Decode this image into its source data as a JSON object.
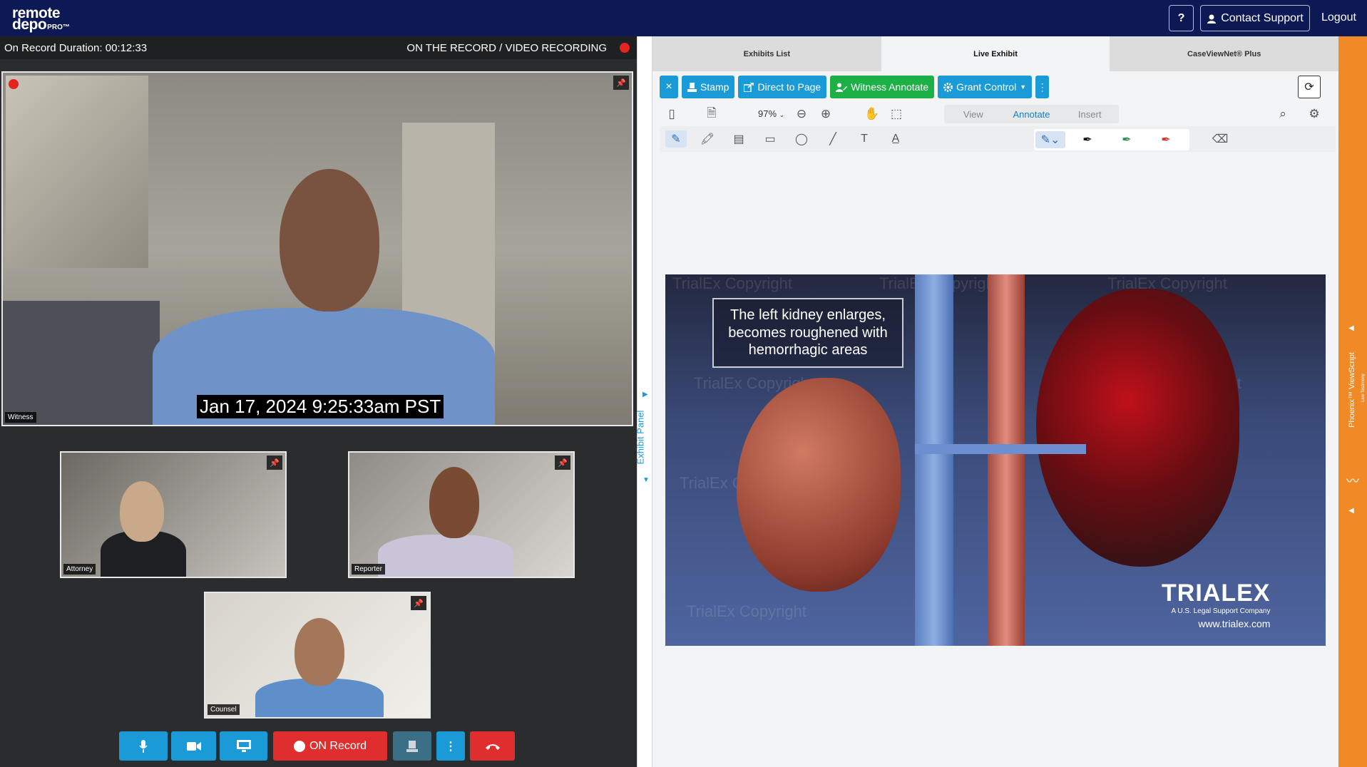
{
  "header": {
    "logo_line1": "remote",
    "logo_line2": "depo",
    "logo_pro": "PRO™",
    "help_label": "?",
    "contact_label": "Contact Support",
    "logout_label": "Logout"
  },
  "recording": {
    "duration": "On Record Duration: 00:12:33",
    "status": "ON THE RECORD / VIDEO RECORDING"
  },
  "video": {
    "witness_label": "Witness",
    "timestamp": "Jan 17, 2024  9:25:33am PST",
    "attorney_label": "Attorney",
    "reporter_label": "Reporter",
    "counsel_label": "Counsel"
  },
  "controls": {
    "on_record_label": "ON Record"
  },
  "exhibit_panel": {
    "label": "Exhibit Panel"
  },
  "tabs": [
    {
      "label": "Exhibits List",
      "active": false
    },
    {
      "label": "Live Exhibit",
      "active": true
    },
    {
      "label": "CaseViewNet® Plus",
      "active": false
    }
  ],
  "actions": {
    "close": "×",
    "stamp": "Stamp",
    "direct_to_page": "Direct to Page",
    "witness_annotate": "Witness Annotate",
    "grant_control": "Grant Control",
    "more": "⋮"
  },
  "viewer": {
    "zoom": "97%",
    "modes": [
      "View",
      "Annotate",
      "Insert"
    ],
    "active_mode": "Annotate"
  },
  "exhibit_image": {
    "caption": "The left kidney enlarges, becomes roughened with hemorrhagic areas",
    "watermark": "TrialEx Copyright",
    "brand": "TRIALEX",
    "brand_sub": "A U.S. Legal Support Company",
    "url": "www.trialex.com"
  },
  "side_strip": {
    "title": "Phoenix™ ViewScript",
    "subtitle": "Live Testimony"
  },
  "colors": {
    "nav": "#0d1954",
    "accent_blue": "#1a9bd7",
    "green": "#1cb047",
    "record_red": "#e02d2e",
    "orange": "#f18a26"
  }
}
